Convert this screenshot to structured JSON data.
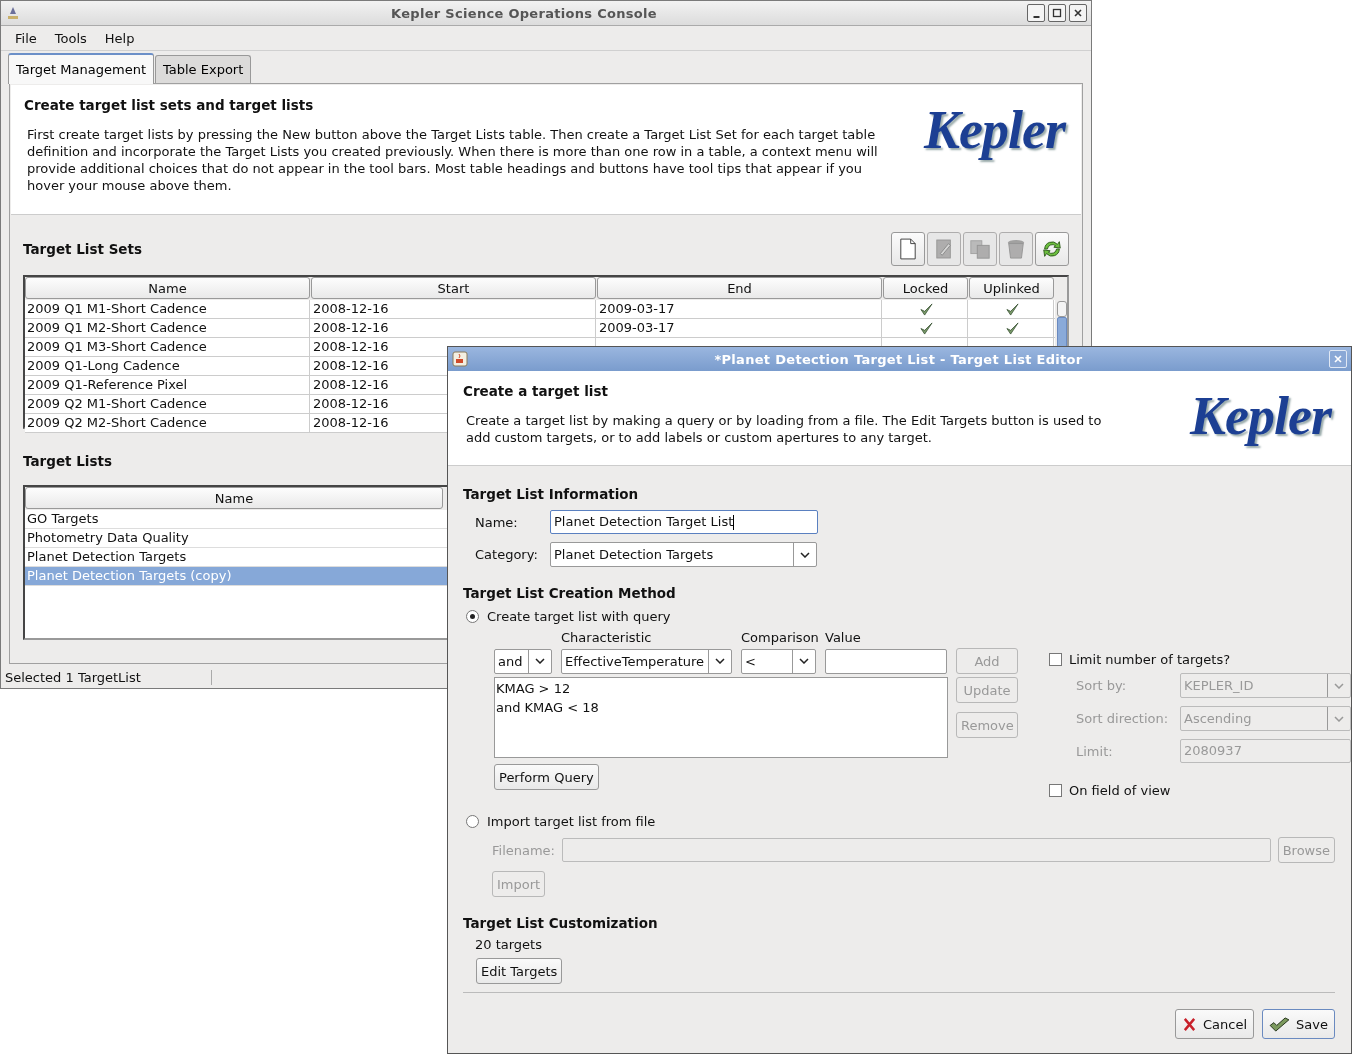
{
  "main_window": {
    "title": "Kepler Science Operations Console",
    "menu": [
      "File",
      "Tools",
      "Help"
    ],
    "tabs": [
      {
        "label": "Target Management",
        "selected": true
      },
      {
        "label": "Table Export",
        "selected": false
      }
    ],
    "header": {
      "title": "Create target list sets and target lists",
      "description": "First create target lists by pressing the New button above the Target Lists table. Then create a Target List Set for each target table definition and incorporate the Target Lists you created previously. When there is more than one row in a table, a context menu will provide additional choices that do not appear in the tool bars. Most table headings and buttons have tool tips that appear if you hover your mouse above them.",
      "logo": "Kepler"
    },
    "target_list_sets": {
      "title": "Target List Sets",
      "toolbar": [
        {
          "kind": "new",
          "disabled": false
        },
        {
          "kind": "edit",
          "disabled": true
        },
        {
          "kind": "copy",
          "disabled": true
        },
        {
          "kind": "delete",
          "disabled": true
        },
        {
          "kind": "refresh",
          "disabled": false
        }
      ],
      "columns": [
        "Name",
        "Start",
        "End",
        "Locked",
        "Uplinked"
      ],
      "rows": [
        {
          "name": "2009 Q1 M1-Short Cadence",
          "start": "2008-12-16",
          "end": "2009-03-17",
          "locked": true,
          "uplinked": true
        },
        {
          "name": "2009 Q1 M2-Short Cadence",
          "start": "2008-12-16",
          "end": "2009-03-17",
          "locked": true,
          "uplinked": true
        },
        {
          "name": "2009 Q1 M3-Short Cadence",
          "start": "2008-12-16"
        },
        {
          "name": "2009 Q1-Long Cadence",
          "start": "2008-12-16"
        },
        {
          "name": "2009 Q1-Reference Pixel",
          "start": "2008-12-16"
        },
        {
          "name": "2009 Q2 M1-Short Cadence",
          "start": "2008-12-16"
        },
        {
          "name": "2009 Q2 M2-Short Cadence",
          "start": "2008-12-16"
        }
      ]
    },
    "target_lists": {
      "title": "Target Lists",
      "columns": [
        "Name"
      ],
      "rows": [
        {
          "name": "GO Targets",
          "selected": false
        },
        {
          "name": "Photometry Data Quality",
          "selected": false
        },
        {
          "name": "Planet Detection Targets",
          "selected": false
        },
        {
          "name": "Planet Detection Targets (copy)",
          "selected": true
        }
      ]
    },
    "status_bar": "Selected 1 TargetList"
  },
  "dialog": {
    "title": "*Planet Detection Target List - Target List Editor",
    "header": {
      "title": "Create a target list",
      "description": "Create a target list by making a query or by loading from a file. The Edit Targets button is used to add custom targets, or to add labels or custom apertures to any target.",
      "logo": "Kepler"
    },
    "info": {
      "title": "Target List Information",
      "name_label": "Name:",
      "name_value": "Planet Detection Target List",
      "category_label": "Category:",
      "category_value": "Planet Detection Targets"
    },
    "method": {
      "title": "Target List Creation Method",
      "options": [
        {
          "label": "Create target list with query",
          "selected": true
        },
        {
          "label": "Import target list from file",
          "selected": false
        }
      ],
      "characteristic_label": "Characteristic",
      "comparison_label": "Comparison",
      "value_label": "Value",
      "conjunction": "and",
      "characteristic": "EffectiveTemperature",
      "comparison": "<",
      "query_lines": [
        "KMAG > 12",
        "and KMAG < 18"
      ],
      "query_buttons": [
        {
          "label": "Add",
          "disabled": true
        },
        {
          "label": "Update",
          "disabled": true
        },
        {
          "label": "Remove",
          "disabled": true
        }
      ],
      "perform_button": "Perform Query",
      "limit": {
        "label": "Limit number of targets?",
        "checked": false
      },
      "limit_fields": [
        {
          "label": "Sort by:",
          "value": "KEPLER_ID",
          "kind": "dropdown"
        },
        {
          "label": "Sort direction:",
          "value": "Ascending",
          "kind": "dropdown"
        },
        {
          "label": "Limit:",
          "value": "2080937",
          "kind": "field"
        }
      ],
      "limit_fields_disabled": true,
      "field_of_view": {
        "label": "On field of view",
        "checked": false
      },
      "filename_label": "Filename:",
      "browse_button": "Browse",
      "import_button": "Import",
      "import_disabled": true
    },
    "customization": {
      "title": "Target List Customization",
      "count": "20 targets",
      "edit_button": "Edit Targets"
    },
    "buttons": [
      {
        "kind": "cancel",
        "label": "Cancel"
      },
      {
        "kind": "save",
        "label": "Save"
      }
    ]
  }
}
